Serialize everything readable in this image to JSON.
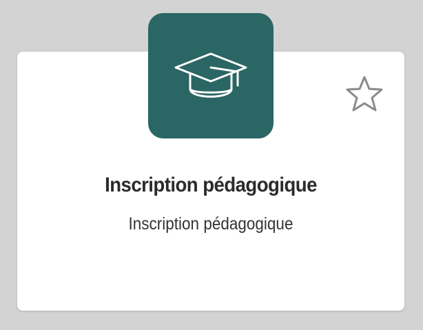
{
  "card": {
    "title": "Inscription pédagogique",
    "subtitle": "Inscription pédagogique",
    "icon": "graduation-cap-icon",
    "favorite_icon": "star-outline-icon"
  },
  "colors": {
    "background": "#d3d3d3",
    "card": "#ffffff",
    "icon_tile": "#2a6664",
    "star": "#8a8a8a"
  }
}
